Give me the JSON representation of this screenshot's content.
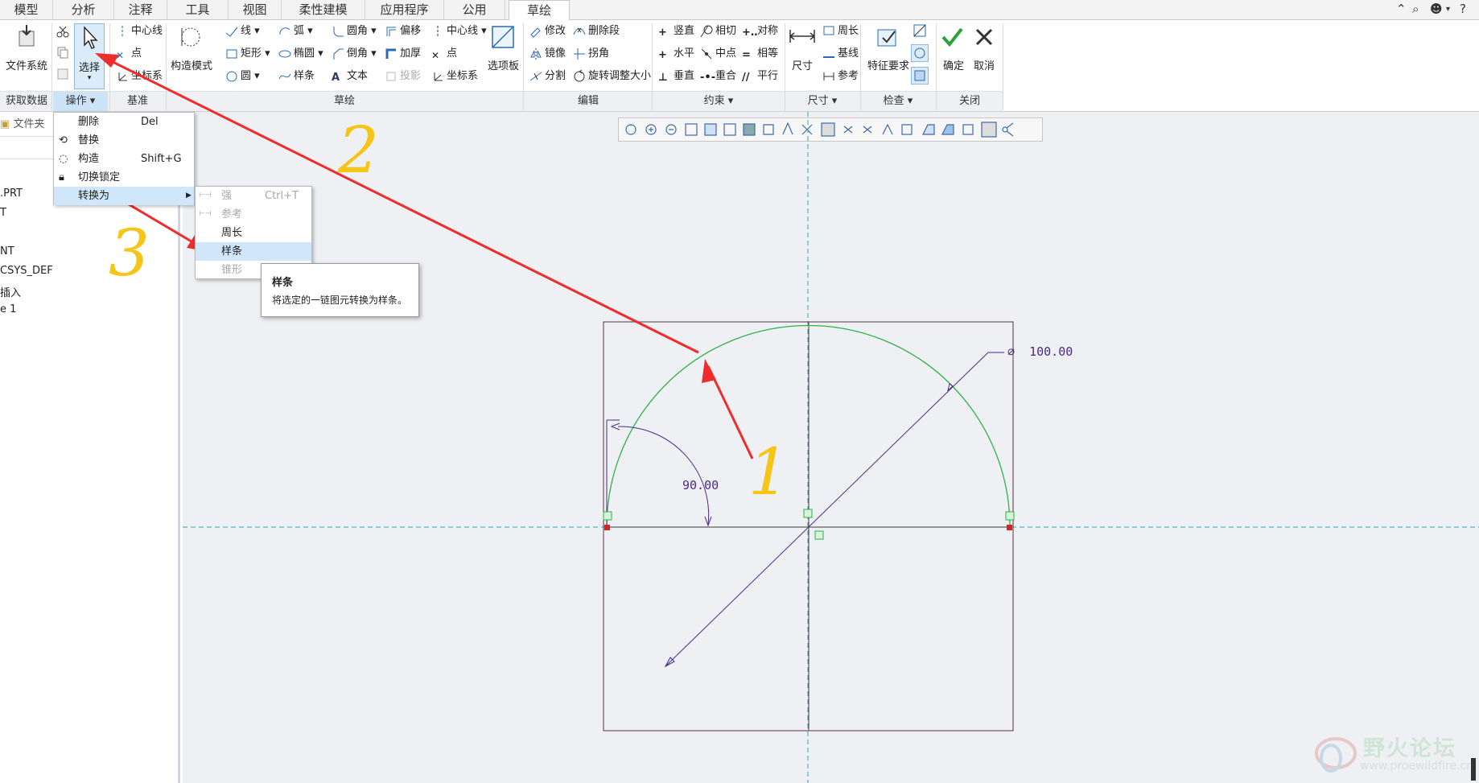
{
  "tabs": [
    "模型",
    "分析",
    "注释",
    "工具",
    "视图",
    "柔性建模",
    "应用程序",
    "公用",
    "草绘"
  ],
  "active_tab": "草绘",
  "ribbon": {
    "get_data": {
      "file_system": "文件系统",
      "group": "获取数据"
    },
    "operations": {
      "select": "选择",
      "group": "操作"
    },
    "datum": {
      "centerline": "中心线",
      "point": "点",
      "coord": "坐标系",
      "group": "基准"
    },
    "sketch": {
      "construction_mode": "构造模式",
      "line": "线",
      "rect": "矩形",
      "circle": "圆",
      "arc": "弧",
      "ellipse": "椭圆",
      "spline": "样条",
      "fillet": "圆角",
      "chamfer": "倒角",
      "text": "文本",
      "offset": "偏移",
      "thicken": "加厚",
      "project": "投影",
      "centerline": "中心线",
      "point": "点",
      "coord": "坐标系",
      "palette": "选项板",
      "group": "草绘"
    },
    "edit": {
      "modify": "修改",
      "mirror": "镜像",
      "divide": "分割",
      "delete_seg": "删除段",
      "corner": "拐角",
      "rotate_resize": "旋转调整大小",
      "group": "编辑"
    },
    "constrain": {
      "vertical": "竖直",
      "horizontal": "水平",
      "perpendicular": "垂直",
      "tangent": "相切",
      "midpoint": "中点",
      "coincident": "重合",
      "symmetric": "对称",
      "equal": "相等",
      "parallel": "平行",
      "group": "约束"
    },
    "dimension": {
      "dimension": "尺寸",
      "perimeter": "周长",
      "baseline": "基线",
      "reference": "参考",
      "group": "尺寸"
    },
    "inspect": {
      "feature_req": "特征要求",
      "group": "检查"
    },
    "close": {
      "ok": "确定",
      "cancel": "取消",
      "group": "关闭"
    }
  },
  "left_panel": {
    "folder_tab": "文件夹",
    "items": [
      ".PRT",
      "T",
      "NT",
      "CSYS_DEF",
      "插入",
      "e 1"
    ]
  },
  "ops_menu": {
    "items": [
      {
        "label": "删除",
        "shortcut": "Del"
      },
      {
        "label": "替换",
        "shortcut": ""
      },
      {
        "label": "构造",
        "shortcut": "Shift+G"
      },
      {
        "label": "切换锁定",
        "shortcut": ""
      },
      {
        "label": "转换为",
        "shortcut": ""
      }
    ]
  },
  "convert_menu": {
    "items": [
      {
        "label": "强",
        "shortcut": "Ctrl+T"
      },
      {
        "label": "参考",
        "shortcut": ""
      },
      {
        "label": "周长",
        "shortcut": ""
      },
      {
        "label": "样条",
        "shortcut": ""
      },
      {
        "label": "锥形",
        "shortcut": ""
      }
    ]
  },
  "tooltip": {
    "title": "样条",
    "desc": "将选定的一链图元转换为样条。"
  },
  "sketch": {
    "diameter": "100.00",
    "angle": "90.00"
  },
  "annotations": [
    "1",
    "2",
    "3"
  ],
  "watermark": {
    "name": "野火论坛",
    "url": "www.proewildfire.cn"
  },
  "colors": {
    "arrow": "#ee2c2c",
    "number": "#f5c518",
    "arc": "#2fb24a",
    "dim": "#4a2a86",
    "centerline": "#2aa9a9",
    "highlight": "#cfe6fb"
  }
}
